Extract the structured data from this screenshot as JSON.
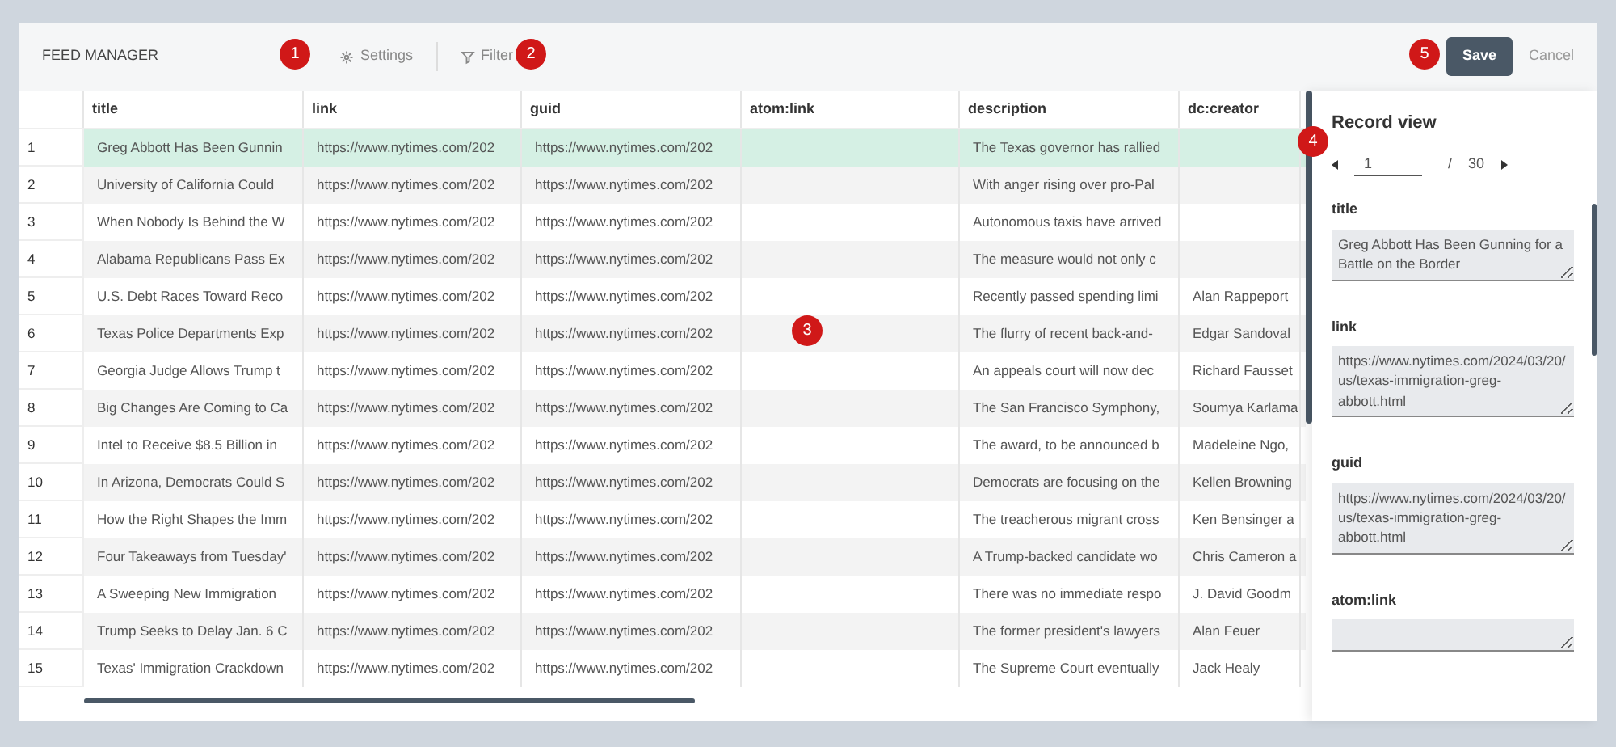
{
  "app_title": "FEED MANAGER",
  "toolbar": [
    {
      "kind": "settings",
      "label": "Settings"
    },
    {
      "kind": "filter",
      "label": "Filter"
    }
  ],
  "actions": {
    "save": "Save",
    "cancel": "Cancel"
  },
  "table": {
    "columns": [
      "title",
      "link",
      "guid",
      "atom:link",
      "description",
      "dc:creator"
    ],
    "rows": [
      {
        "number": "1",
        "selected": true,
        "cells": [
          "Greg Abbott Has Been Gunnin",
          "https://www.nytimes.com/202",
          "https://www.nytimes.com/202",
          "",
          "The Texas governor has rallied",
          ""
        ]
      },
      {
        "number": "2",
        "selected": false,
        "cells": [
          "University of California Could",
          "https://www.nytimes.com/202",
          "https://www.nytimes.com/202",
          "",
          "With anger rising over pro-Pal",
          ""
        ]
      },
      {
        "number": "3",
        "selected": false,
        "cells": [
          "When Nobody Is Behind the W",
          "https://www.nytimes.com/202",
          "https://www.nytimes.com/202",
          "",
          "Autonomous taxis have arrived",
          ""
        ]
      },
      {
        "number": "4",
        "selected": false,
        "cells": [
          "Alabama Republicans Pass Ex",
          "https://www.nytimes.com/202",
          "https://www.nytimes.com/202",
          "",
          "The measure would not only c",
          ""
        ]
      },
      {
        "number": "5",
        "selected": false,
        "cells": [
          "U.S. Debt Races Toward Reco",
          "https://www.nytimes.com/202",
          "https://www.nytimes.com/202",
          "",
          "Recently passed spending limi",
          "Alan Rappeport"
        ]
      },
      {
        "number": "6",
        "selected": false,
        "cells": [
          "Texas Police Departments Exp",
          "https://www.nytimes.com/202",
          "https://www.nytimes.com/202",
          "",
          "The flurry of recent back-and-",
          "Edgar Sandoval"
        ]
      },
      {
        "number": "7",
        "selected": false,
        "cells": [
          "Georgia Judge Allows Trump t",
          "https://www.nytimes.com/202",
          "https://www.nytimes.com/202",
          "",
          "An appeals court will now dec",
          "Richard Fausset"
        ]
      },
      {
        "number": "8",
        "selected": false,
        "cells": [
          "Big Changes Are Coming to Ca",
          "https://www.nytimes.com/202",
          "https://www.nytimes.com/202",
          "",
          "The San Francisco Symphony,",
          "Soumya Karlama"
        ]
      },
      {
        "number": "9",
        "selected": false,
        "cells": [
          "Intel to Receive $8.5 Billion in",
          "https://www.nytimes.com/202",
          "https://www.nytimes.com/202",
          "",
          "The award, to be announced b",
          "Madeleine Ngo,"
        ]
      },
      {
        "number": "10",
        "selected": false,
        "cells": [
          "In Arizona, Democrats Could S",
          "https://www.nytimes.com/202",
          "https://www.nytimes.com/202",
          "",
          "Democrats are focusing on the",
          "Kellen Browning"
        ]
      },
      {
        "number": "11",
        "selected": false,
        "cells": [
          "How the Right Shapes the Imm",
          "https://www.nytimes.com/202",
          "https://www.nytimes.com/202",
          "",
          "The treacherous migrant cross",
          "Ken Bensinger a"
        ]
      },
      {
        "number": "12",
        "selected": false,
        "cells": [
          "Four Takeaways from Tuesday'",
          "https://www.nytimes.com/202",
          "https://www.nytimes.com/202",
          "",
          "A Trump-backed candidate wo",
          "Chris Cameron a"
        ]
      },
      {
        "number": "13",
        "selected": false,
        "cells": [
          "A Sweeping New Immigration",
          "https://www.nytimes.com/202",
          "https://www.nytimes.com/202",
          "",
          "There was no immediate respo",
          "J. David Goodm"
        ]
      },
      {
        "number": "14",
        "selected": false,
        "cells": [
          "Trump Seeks to Delay Jan. 6 C",
          "https://www.nytimes.com/202",
          "https://www.nytimes.com/202",
          "",
          "The former president's lawyers",
          "Alan Feuer"
        ]
      },
      {
        "number": "15",
        "selected": false,
        "cells": [
          "Texas' Immigration Crackdown",
          "https://www.nytimes.com/202",
          "https://www.nytimes.com/202",
          "",
          "The Supreme Court eventually",
          "Jack Healy"
        ]
      }
    ]
  },
  "record_view": {
    "title": "Record view",
    "page": "1",
    "separator": "/",
    "total": "30",
    "fields": [
      {
        "label": "title",
        "value": "Greg Abbott Has Been Gunning for a Battle on the Border"
      },
      {
        "label": "link",
        "value": "https://www.nytimes.com/2024/03/20/us/texas-immigration-greg-abbott.html"
      },
      {
        "label": "guid",
        "value": "https://www.nytimes.com/2024/03/20/us/texas-immigration-greg-abbott.html"
      },
      {
        "label": "atom:link"
      }
    ]
  },
  "markers": [
    {
      "label": "1"
    },
    {
      "label": "2"
    },
    {
      "label": "3"
    },
    {
      "label": "4"
    },
    {
      "label": "5"
    }
  ]
}
